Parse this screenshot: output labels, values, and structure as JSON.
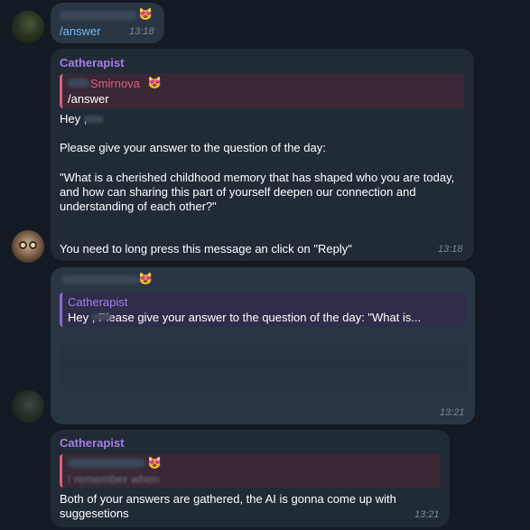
{
  "messages": [
    {
      "command": "/answer",
      "time": "13:18",
      "emoji": "😻"
    },
    {
      "sender": "Catherapist",
      "reply": {
        "name": "Smirnova",
        "emoji": "😻",
        "text": "/answer"
      },
      "greeting": "Hey ,",
      "intro": "Please give your answer to the question of the day:",
      "question": "\"What is a cherished childhood memory that has shaped who you are today, and how can sharing this part of yourself deepen our connection and understanding of each other?\"",
      "instruction": "You need to long press this message an click on \"Reply\"",
      "time": "13:18"
    },
    {
      "emoji": "😻",
      "reply": {
        "name": "Catherapist",
        "text": "Hey ,  Please give your answer to the question of the day:  \"What is..."
      },
      "time": "13:21"
    },
    {
      "sender": "Catherapist",
      "reply": {
        "emoji": "😻",
        "text": "I remember when"
      },
      "text": "Both of your answers are gathered, the AI is gonna come up with suggesetions",
      "time": "13:21"
    }
  ],
  "colors": {
    "background": "#141a23",
    "bubble": "#212b36",
    "accent_purple": "#a57de6",
    "reply_pink": "#e35a7a",
    "link_blue": "#6fb8f5"
  }
}
